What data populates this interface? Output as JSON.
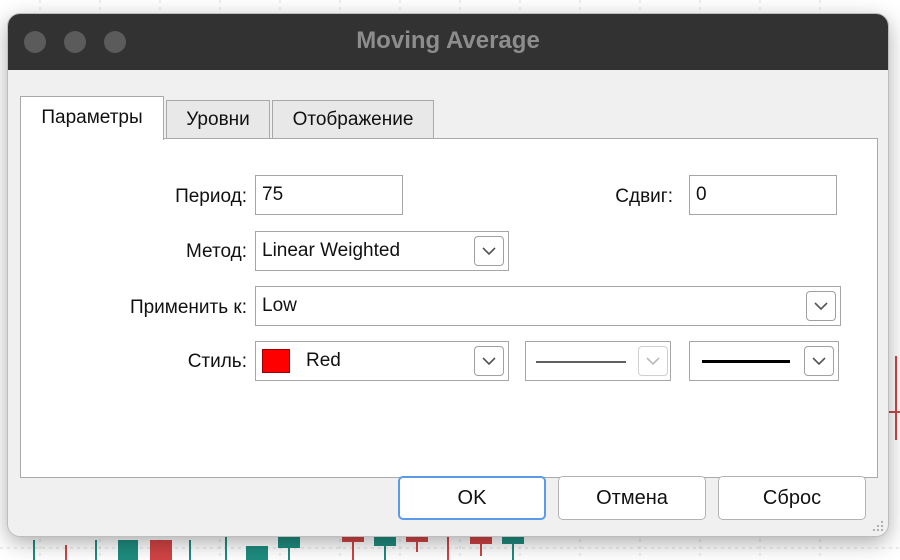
{
  "window": {
    "title": "Moving Average"
  },
  "tabs": [
    {
      "label": "Параметры",
      "active": true
    },
    {
      "label": "Уровни",
      "active": false
    },
    {
      "label": "Отображение",
      "active": false
    }
  ],
  "params": {
    "period_label": "Период:",
    "period_value": "75",
    "shift_label": "Сдвиг:",
    "shift_value": "0",
    "method_label": "Метод:",
    "method_value": "Linear Weighted",
    "apply_label": "Применить к:",
    "apply_value": "Low",
    "style_label": "Стиль:",
    "style_color_name": "Red",
    "style_color_hex": "#ff0000"
  },
  "buttons": {
    "ok": "OK",
    "cancel": "Отмена",
    "reset": "Сброс"
  },
  "colors": {
    "titlebar": "#323232",
    "accent_focus": "#5b9ae8",
    "candle_bull": "#1e8c7e",
    "candle_bear": "#d14444"
  }
}
